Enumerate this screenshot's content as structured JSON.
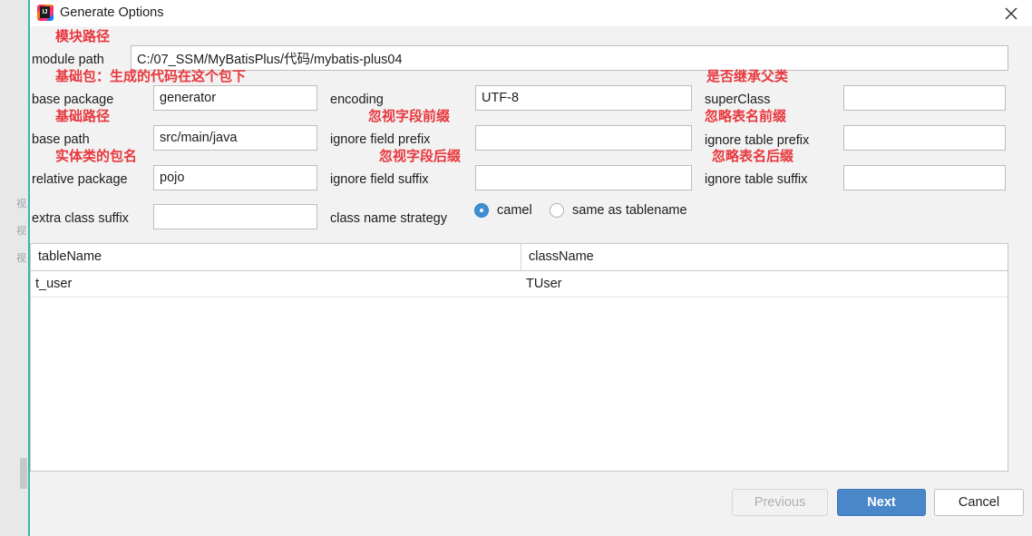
{
  "window": {
    "title": "Generate Options",
    "app_icon": "intellij-idea-icon",
    "close_icon": "close-icon"
  },
  "form": {
    "module_path": {
      "label": "module path",
      "note": "模块路径",
      "value": "C:/07_SSM/MyBatisPlus/代码/mybatis-plus04",
      "placeholder": ""
    },
    "base_package": {
      "label": "base package",
      "note": "基础包：生成的代码在这个包下",
      "value": "generator",
      "placeholder": ""
    },
    "base_path": {
      "label": "base path",
      "note": "基础路径",
      "value": "src/main/java",
      "placeholder": ""
    },
    "relative_package": {
      "label": "relative package",
      "note": "实体类的包名",
      "value": "pojo",
      "placeholder": ""
    },
    "extra_class_suffix": {
      "label": "extra class suffix",
      "note": "",
      "value": "",
      "placeholder": ""
    },
    "encoding": {
      "label": "encoding",
      "note": "",
      "value": "UTF-8",
      "placeholder": ""
    },
    "ignore_field_prefix": {
      "label": "ignore field prefix",
      "note": "忽视字段前缀",
      "value": "",
      "placeholder": ""
    },
    "ignore_field_suffix": {
      "label": "ignore field suffix",
      "note": "忽视字段后缀",
      "value": "",
      "placeholder": ""
    },
    "super_class": {
      "label": "superClass",
      "note": "是否继承父类",
      "value": "",
      "placeholder": ""
    },
    "ignore_table_prefix": {
      "label": "ignore table prefix",
      "note": "忽略表名前缀",
      "value": "",
      "placeholder": ""
    },
    "ignore_table_suffix": {
      "label": "ignore table suffix",
      "note": "忽略表名后缀",
      "value": "",
      "placeholder": ""
    },
    "class_name_strategy": {
      "label": "class name strategy",
      "options": [
        {
          "label": "camel",
          "selected": true
        },
        {
          "label": "same as tablename",
          "selected": false
        }
      ]
    }
  },
  "table": {
    "columns": [
      "tableName",
      "className"
    ],
    "rows": [
      {
        "tableName": "t_user",
        "className": "TUser"
      }
    ]
  },
  "footer": {
    "previous_label": "Previous",
    "next_label": "Next",
    "cancel_label": "Cancel"
  },
  "colors": {
    "note_red": "#e8373d",
    "primary_blue": "#4a87c8",
    "ide_accent": "#3cb6a8",
    "dialog_bg": "#f2f2f2"
  }
}
